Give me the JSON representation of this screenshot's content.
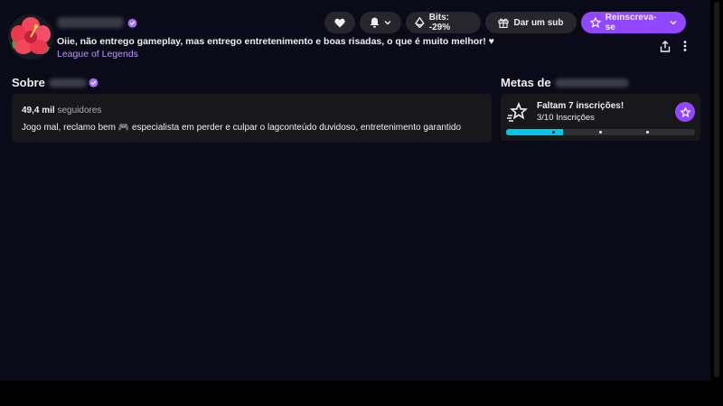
{
  "header": {
    "stream_title": "Oiie, não entrego gameplay, mas entrego entretenimento e boas risadas, o que é muito melhor! ♥",
    "category": "League of Legends"
  },
  "actions": {
    "bits_label": "Bits: -29%",
    "gift_label": "Dar um sub",
    "resubscribe_label": "Reinscreva-se"
  },
  "about": {
    "title_prefix": "Sobre",
    "followers_count": "49,4 mil",
    "followers_label": "seguidores",
    "bio": "Jogo mal, reclamo bem 🎮 especialista em perder e culpar o lagconteúdo duvidoso, entretenimento garantido"
  },
  "goals": {
    "title_prefix": "Metas de",
    "goal_title": "Faltam 7 inscrições!",
    "goal_progress_text": "3/10 Inscrições",
    "progress_current": 3,
    "progress_target": 10
  },
  "colors": {
    "accent_purple": "#9147ff",
    "link_purple": "#bf94ff",
    "progress_cyan": "#00c8e8",
    "background": "#0a0a18",
    "card": "#18181b"
  },
  "icons": {
    "avatar": "hibiscus-flower",
    "follow": "heart-icon",
    "notify": "bell-icon",
    "bits": "bits-gem-icon",
    "gift": "gift-icon",
    "subscribe": "star-icon",
    "share": "share-icon",
    "more": "kebab-icon",
    "verified": "verified-badge-icon"
  }
}
